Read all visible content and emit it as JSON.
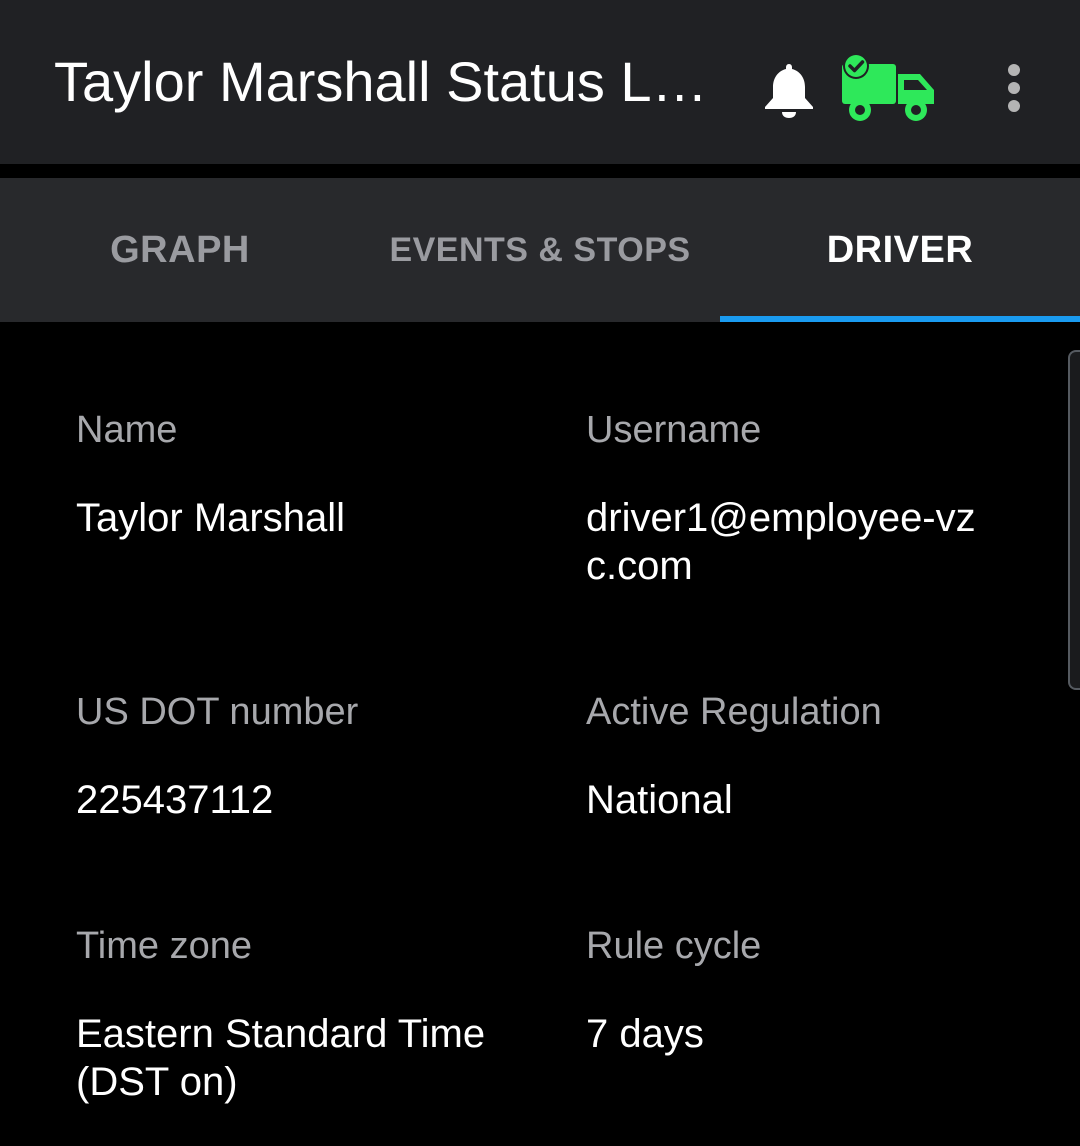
{
  "header": {
    "title": "Taylor Marshall Status Logs",
    "icons": {
      "notification": "bell-icon",
      "status": "truck-check-icon",
      "menu": "more-vert-icon"
    },
    "status_color": "#2ee85a"
  },
  "tabs": [
    {
      "label": "GRAPH",
      "active": false
    },
    {
      "label": "EVENTS & STOPS",
      "active": false
    },
    {
      "label": "DRIVER",
      "active": true
    }
  ],
  "accent_color": "#1a9bf0",
  "driver": {
    "name": {
      "label": "Name",
      "value": "Taylor Marshall"
    },
    "username": {
      "label": "Username",
      "value": "driver1@employee-vzc.com"
    },
    "dot": {
      "label": "US DOT number",
      "value": "225437112"
    },
    "regulation": {
      "label": "Active Regulation",
      "value": "National"
    },
    "timezone": {
      "label": "Time zone",
      "value": "Eastern Standard Time (DST on)"
    },
    "cycle": {
      "label": "Rule cycle",
      "value": "7 days"
    }
  }
}
